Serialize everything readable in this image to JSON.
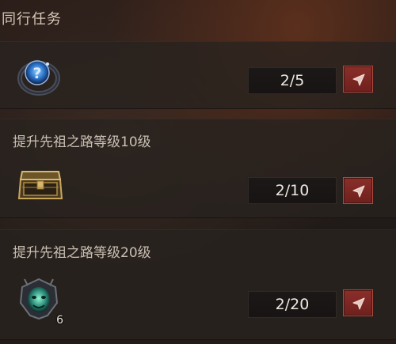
{
  "header": {
    "title": "同行任务"
  },
  "tasks": [
    {
      "label": "",
      "progress": "2/5",
      "icon": "ring-question-icon",
      "count": ""
    },
    {
      "label": "提升先祖之路等级10级",
      "progress": "2/10",
      "icon": "treasure-chest-icon",
      "count": ""
    },
    {
      "label": "提升先祖之路等级20级",
      "progress": "2/20",
      "icon": "demon-sigil-icon",
      "count": "6"
    }
  ],
  "colors": {
    "button_red": "#7d2824",
    "progress_bg": "#1a1716",
    "panel_bg": "#28221f"
  }
}
